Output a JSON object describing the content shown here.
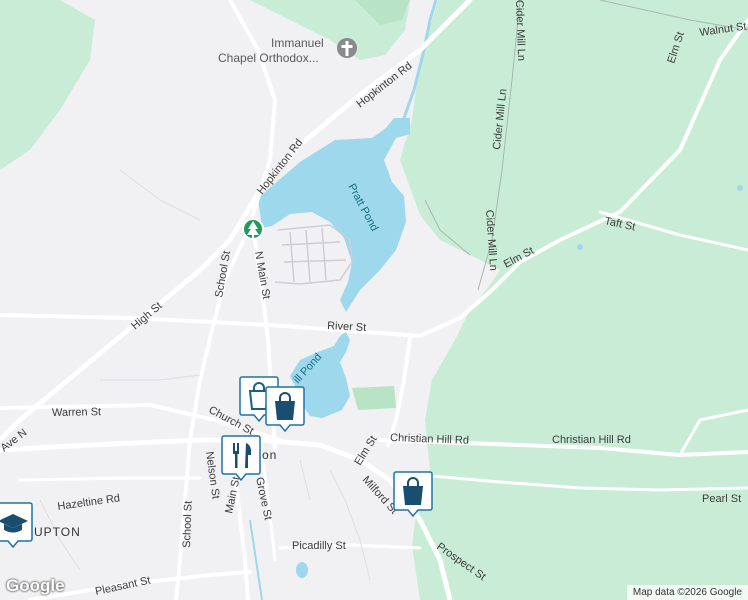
{
  "map": {
    "streets": {
      "hopkinton_rd_upper": "Hopkinton Rd",
      "hopkinton_rd_lower": "Hopkinton Rd",
      "cider_mill_top": "Cider Mill Ln",
      "cider_mill_mid": "Cider Mill Ln",
      "cider_mill_low": "Cider Mill Ln",
      "walnut": "Walnut St",
      "elm_ne": "Elm St",
      "elm_mid": "Elm St",
      "elm_south": "Elm St",
      "taft": "Taft St",
      "high": "High St",
      "school_upper": "School St",
      "school_lower": "School St",
      "n_main": "N Main St",
      "river": "River St",
      "warren": "Warren St",
      "church": "Church St",
      "christian_hill_w": "Christian Hill Rd",
      "christian_hill_e": "Christian Hill Rd",
      "nelson": "Nelson St",
      "main": "Main St",
      "grove": "Grove St",
      "hazeltine": "Hazeltine Rd",
      "milford": "Milford St",
      "pearl": "Pearl St",
      "prospect": "Prospect St",
      "picadilly": "Picadilly St",
      "pleasant": "Pleasant St",
      "ave_n": "Ave N"
    },
    "water": {
      "pratt_pond": "Pratt Pond",
      "mill_pond": "ill Pond"
    },
    "pois": {
      "church_line1": "Immanuel",
      "church_line2": "Chapel Orthodox..."
    },
    "places": {
      "upton": "UPTON",
      "town_center": "on"
    },
    "markers": [
      {
        "name": "shopping-marker-1",
        "icon": "shopping-bag-icon"
      },
      {
        "name": "shopping-marker-2",
        "icon": "shopping-bag-icon"
      },
      {
        "name": "restaurant-marker",
        "icon": "restaurant-icon"
      },
      {
        "name": "school-marker",
        "icon": "graduation-cap-icon"
      },
      {
        "name": "park-marker",
        "icon": "tree-icon"
      },
      {
        "name": "church-marker",
        "icon": "cross-icon"
      }
    ],
    "colors": {
      "land": "#f1f0f2",
      "forest": "#c9ecd6",
      "forest_dark": "#b8e3c4",
      "water": "#9ed8ec",
      "road": "#ffffff",
      "marker": "#1a73a8"
    }
  },
  "footer": {
    "logo": "Google",
    "attribution": "Map data ©2026 Google"
  }
}
